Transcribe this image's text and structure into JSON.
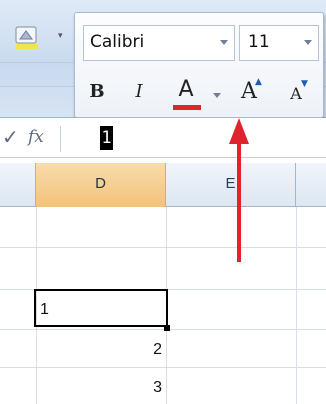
{
  "mini_toolbar": {
    "font_name": "Calibri",
    "font_size": "11",
    "bold_label": "B",
    "italic_label": "I",
    "font_color_label": "A",
    "grow_font_label": "A",
    "shrink_font_label": "A",
    "font_color": "#e0242f"
  },
  "formula_bar": {
    "enter_icon": "check-icon",
    "function_icon": "fx",
    "value": "1"
  },
  "grid": {
    "columns": [
      "D",
      "E"
    ],
    "selected_column": "D",
    "cells": {
      "d_row4": "1",
      "d_row5": "2",
      "d_row6": "3"
    }
  },
  "annotation": {
    "arrow_color": "#e0242f",
    "points_to": "grow-font-button"
  }
}
